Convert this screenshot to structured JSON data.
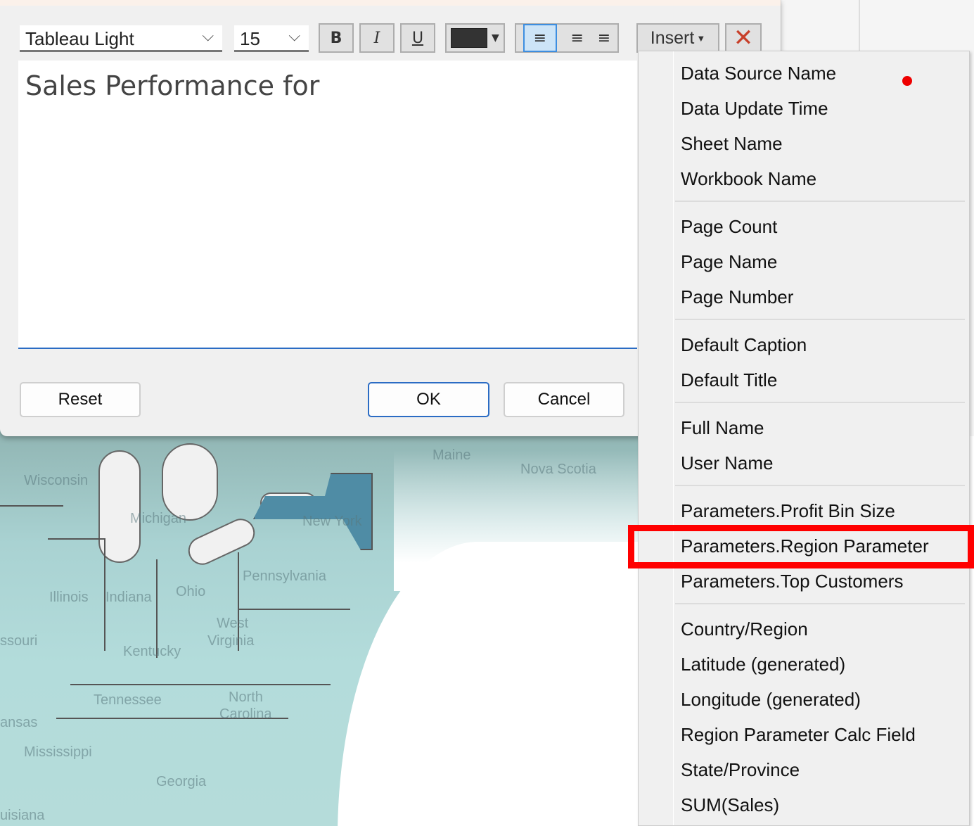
{
  "toolbar": {
    "font": "Tableau Light",
    "size": "15",
    "bold": "B",
    "italic": "I",
    "underline": "U",
    "insert": "Insert",
    "text_color": "#333333"
  },
  "editor": {
    "text": "Sales Performance for"
  },
  "buttons": {
    "reset": "Reset",
    "ok": "OK",
    "cancel": "Cancel"
  },
  "menu": {
    "groups": [
      [
        "Data Source Name",
        "Data Update Time",
        "Sheet Name",
        "Workbook Name"
      ],
      [
        "Page Count",
        "Page Name",
        "Page Number"
      ],
      [
        "Default Caption",
        "Default Title"
      ],
      [
        "Full Name",
        "User Name"
      ],
      [
        "Parameters.Profit Bin Size",
        "Parameters.Region Parameter",
        "Parameters.Top Customers"
      ],
      [
        "Country/Region",
        "Latitude (generated)",
        "Longitude (generated)",
        "Region Parameter Calc Field",
        "State/Province",
        "SUM(Sales)"
      ]
    ],
    "highlighted": "Parameters.Region Parameter"
  },
  "map": {
    "labels": [
      "Wisconsin",
      "Michigan",
      "New York",
      "Maine",
      "Nova Scotia",
      "Pennsylvania",
      "Illinois",
      "Indiana",
      "Ohio",
      "West",
      "Virginia",
      "Kentucky",
      "ssouri",
      "Tennessee",
      "North",
      "Carolina",
      "ansas",
      "Mississippi",
      "Georgia",
      "uisiana"
    ]
  }
}
